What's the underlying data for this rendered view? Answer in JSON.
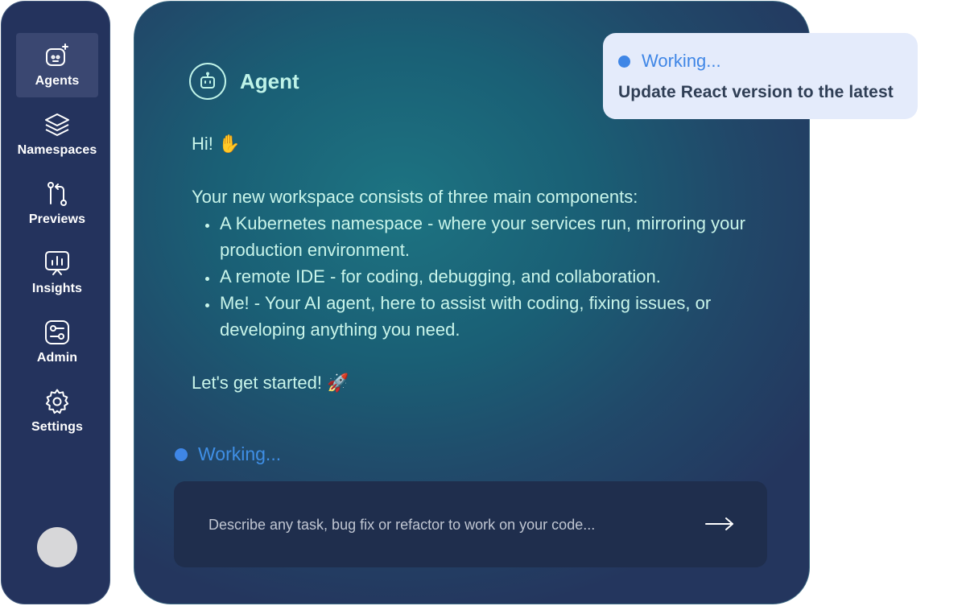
{
  "sidebar": {
    "items": [
      {
        "label": "Agents",
        "icon": "agent-sparkle-icon",
        "active": true
      },
      {
        "label": "Namespaces",
        "icon": "layers-icon",
        "active": false
      },
      {
        "label": "Previews",
        "icon": "branch-icon",
        "active": false
      },
      {
        "label": "Insights",
        "icon": "chart-board-icon",
        "active": false
      },
      {
        "label": "Admin",
        "icon": "sliders-icon",
        "active": false
      },
      {
        "label": "Settings",
        "icon": "gear-icon",
        "active": false
      }
    ]
  },
  "agent": {
    "title": "Agent",
    "greeting": "Hi! ✋",
    "intro": "Your new workspace consists of three main components:",
    "bullets": [
      "A Kubernetes namespace - where your services run, mirroring your production environment.",
      "A remote IDE - for coding, debugging, and collaboration.",
      "Me! - Your AI agent, here to assist with coding, fixing issues, or developing anything you need."
    ],
    "closing": "Let's get started! 🚀",
    "status": "Working..."
  },
  "composer": {
    "placeholder": "Describe any task, bug fix or refactor to work on your code..."
  },
  "toast": {
    "status": "Working...",
    "task": "Update React version to the latest"
  },
  "colors": {
    "sidebar_bg": "#24335d",
    "panel_accent": "#1d7482",
    "text_mint": "#c9f5ea",
    "working_blue": "#3f86e6",
    "toast_bg": "#e4ebfb"
  }
}
